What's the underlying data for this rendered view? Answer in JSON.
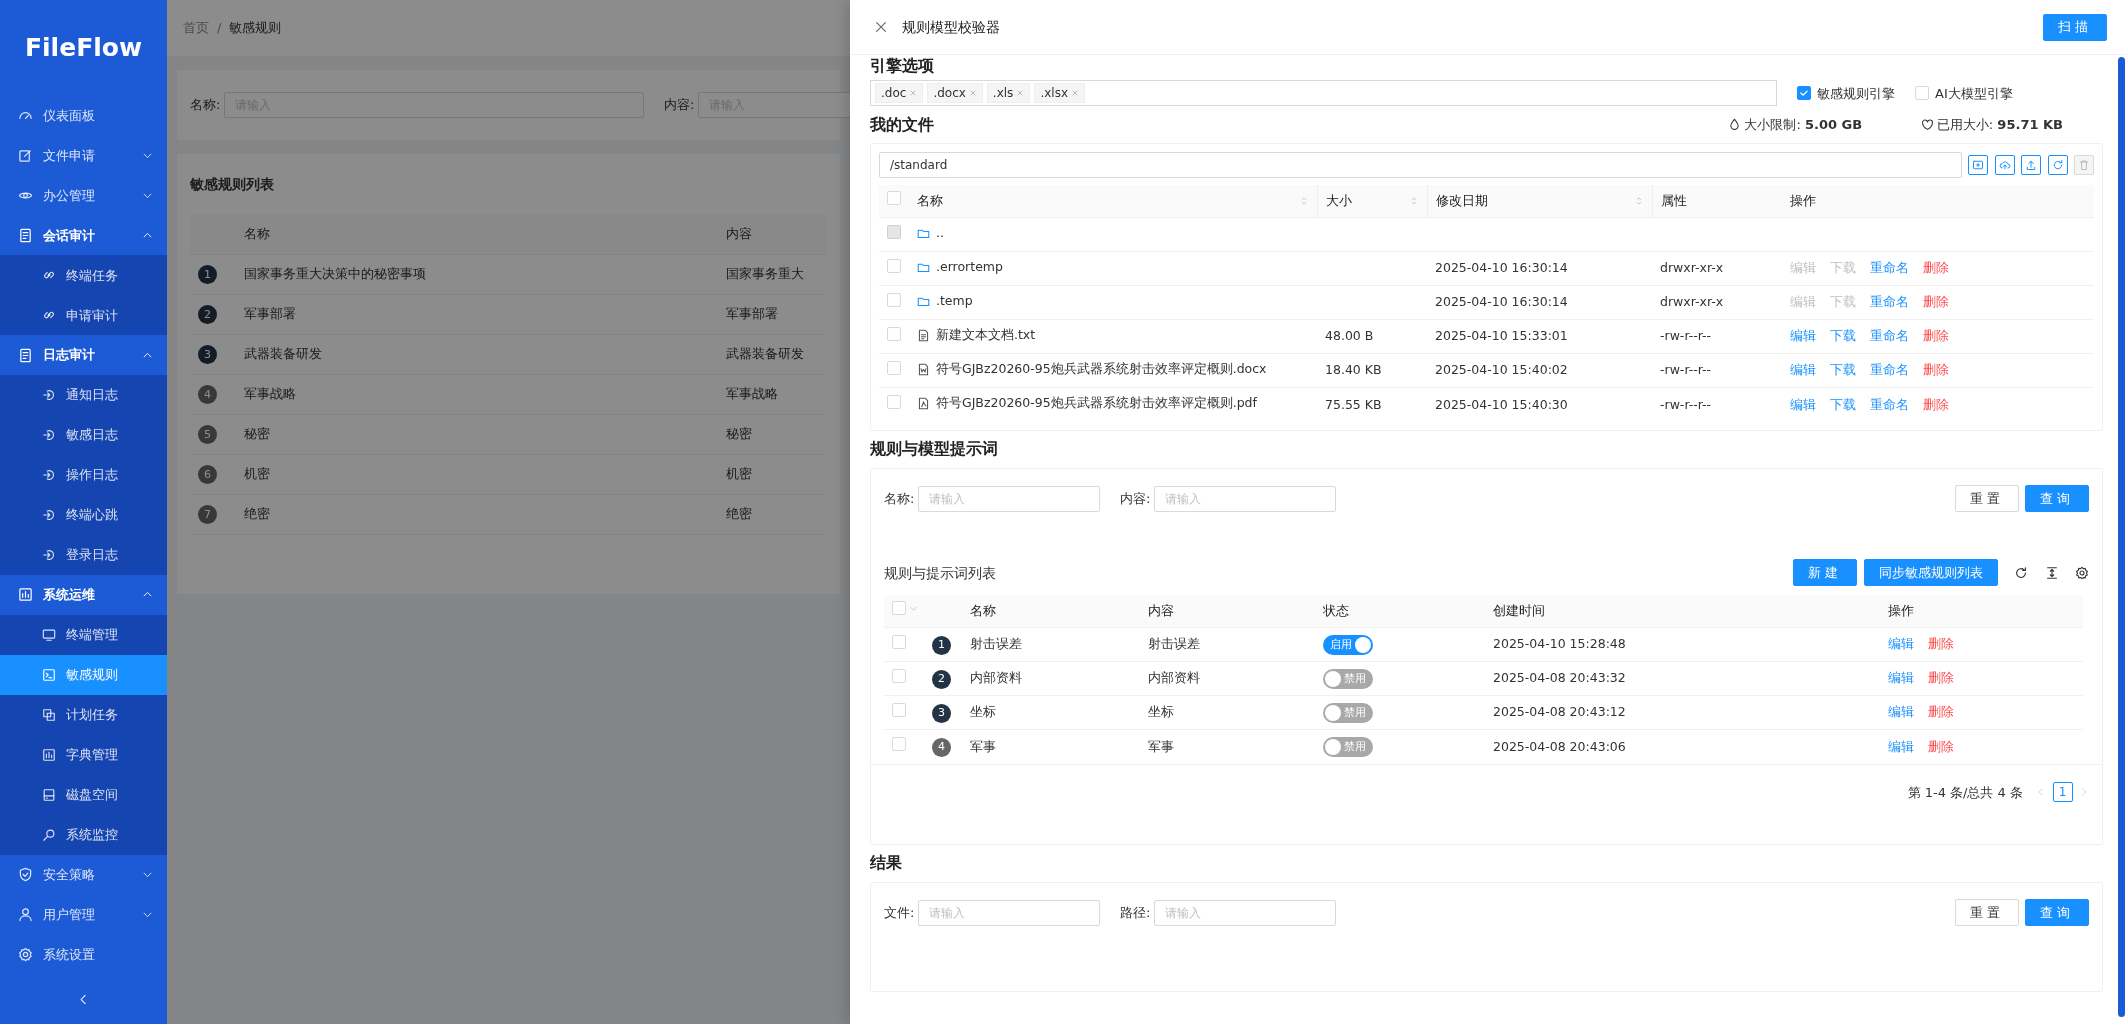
{
  "sidebar": {
    "logo": "FileFlow",
    "items": [
      {
        "label": "仪表面板",
        "selected": false
      },
      {
        "label": "文件申请",
        "selected": false,
        "expanded": false
      },
      {
        "label": "办公管理",
        "selected": false,
        "expanded": false
      },
      {
        "label": "会话审计",
        "selected": false,
        "expanded": true,
        "children": [
          {
            "label": "终端任务",
            "selected": false
          },
          {
            "label": "申请审计",
            "selected": false
          }
        ]
      },
      {
        "label": "日志审计",
        "selected": false,
        "expanded": true,
        "children": [
          {
            "label": "通知日志",
            "selected": false
          },
          {
            "label": "敏感日志",
            "selected": false
          },
          {
            "label": "操作日志",
            "selected": false
          },
          {
            "label": "终端心跳",
            "selected": false
          },
          {
            "label": "登录日志",
            "selected": false
          }
        ]
      },
      {
        "label": "系统运维",
        "selected": false,
        "expanded": true,
        "children": [
          {
            "label": "终端管理",
            "selected": false
          },
          {
            "label": "敏感规则",
            "selected": true
          },
          {
            "label": "计划任务",
            "selected": false
          },
          {
            "label": "字典管理",
            "selected": false
          },
          {
            "label": "磁盘空间",
            "selected": false
          },
          {
            "label": "系统监控",
            "selected": false
          }
        ]
      },
      {
        "label": "安全策略",
        "selected": false,
        "expanded": false
      },
      {
        "label": "用户管理",
        "selected": false,
        "expanded": false
      },
      {
        "label": "系统设置",
        "selected": false
      }
    ]
  },
  "background_page": {
    "breadcrumb": [
      "首页",
      "敏感规则"
    ],
    "breadcrumb_separator": "/",
    "filters": [
      {
        "label": "名称:",
        "placeholder": "请输入"
      },
      {
        "label": "内容:",
        "placeholder": "请输入"
      }
    ],
    "list_title": "敏感规则列表",
    "columns": [
      "名称",
      "内容"
    ],
    "rows": [
      {
        "index": "1",
        "highlight": true,
        "name": "国家事务重大决策中的秘密事项",
        "content": "国家事务重大"
      },
      {
        "index": "2",
        "highlight": true,
        "name": "军事部署",
        "content": "军事部署"
      },
      {
        "index": "3",
        "highlight": true,
        "name": "武器装备研发",
        "content": "武器装备研发"
      },
      {
        "index": "4",
        "highlight": false,
        "name": "军事战略",
        "content": "军事战略"
      },
      {
        "index": "5",
        "highlight": false,
        "name": "秘密",
        "content": "秘密"
      },
      {
        "index": "6",
        "highlight": false,
        "name": "机密",
        "content": "机密"
      },
      {
        "index": "7",
        "highlight": false,
        "name": "绝密",
        "content": "绝密"
      }
    ]
  },
  "drawer": {
    "title": "规则模型校验器",
    "scan_button": "扫描",
    "engine": {
      "heading": "引擎选项",
      "tags": [
        ".doc",
        ".docx",
        ".xls",
        ".xlsx"
      ],
      "options": [
        {
          "label": "敏感规则引擎",
          "checked": true
        },
        {
          "label": "AI大模型引擎",
          "checked": false
        }
      ]
    },
    "files": {
      "heading": "我的文件",
      "quota": [
        {
          "label": "大小限制:",
          "value": "5.00 GB"
        },
        {
          "label": "已用大小:",
          "value": "95.71 KB"
        }
      ],
      "path": "/standard",
      "select_all_checked": false,
      "toolbar": [
        {
          "disabled": false
        },
        {
          "disabled": false
        },
        {
          "disabled": false
        },
        {
          "disabled": false
        },
        {
          "disabled": true
        }
      ],
      "columns": [
        {
          "label": "名称",
          "sortable": true
        },
        {
          "label": "大小",
          "sortable": true
        },
        {
          "label": "修改日期",
          "sortable": true
        },
        {
          "label": "属性",
          "sortable": false
        },
        {
          "label": "操作",
          "sortable": false
        }
      ],
      "rows": [
        {
          "kind": "folder",
          "name": "..",
          "checked": false,
          "check_disabled": true
        },
        {
          "kind": "folder",
          "name": ".errortemp",
          "checked": false,
          "check_disabled": false,
          "modified": "2025-04-10 16:30:14",
          "mode": "drwxr-xr-x",
          "actions": [
            {
              "label": "编辑",
              "kind": "link",
              "disabled": true
            },
            {
              "label": "下载",
              "kind": "link",
              "disabled": true
            },
            {
              "label": "重命名",
              "kind": "link",
              "disabled": false
            },
            {
              "label": "删除",
              "kind": "danger",
              "disabled": false
            }
          ]
        },
        {
          "kind": "folder",
          "name": ".temp",
          "checked": false,
          "check_disabled": false,
          "modified": "2025-04-10 16:30:14",
          "mode": "drwxr-xr-x",
          "actions": [
            {
              "label": "编辑",
              "kind": "link",
              "disabled": true
            },
            {
              "label": "下载",
              "kind": "link",
              "disabled": true
            },
            {
              "label": "重命名",
              "kind": "link",
              "disabled": false
            },
            {
              "label": "删除",
              "kind": "danger",
              "disabled": false
            }
          ]
        },
        {
          "kind": "text",
          "name": "新建文本文档.txt",
          "checked": false,
          "check_disabled": false,
          "size": "48.00 B",
          "modified": "2025-04-10 15:33:01",
          "mode": "-rw-r--r--",
          "actions": [
            {
              "label": "编辑",
              "kind": "link",
              "disabled": false
            },
            {
              "label": "下载",
              "kind": "link",
              "disabled": false
            },
            {
              "label": "重命名",
              "kind": "link",
              "disabled": false
            },
            {
              "label": "删除",
              "kind": "danger",
              "disabled": false
            }
          ]
        },
        {
          "kind": "word",
          "name": "符号GJBz20260-95炮兵武器系统射击效率评定概则.docx",
          "checked": false,
          "check_disabled": false,
          "size": "18.40 KB",
          "modified": "2025-04-10 15:40:02",
          "mode": "-rw-r--r--",
          "actions": [
            {
              "label": "编辑",
              "kind": "link",
              "disabled": false
            },
            {
              "label": "下载",
              "kind": "link",
              "disabled": false
            },
            {
              "label": "重命名",
              "kind": "link",
              "disabled": false
            },
            {
              "label": "删除",
              "kind": "danger",
              "disabled": false
            }
          ]
        },
        {
          "kind": "pdf",
          "name": "符号GJBz20260-95炮兵武器系统射击效率评定概则.pdf",
          "checked": false,
          "check_disabled": false,
          "size": "75.55 KB",
          "modified": "2025-04-10 15:40:30",
          "mode": "-rw-r--r--",
          "actions": [
            {
              "label": "编辑",
              "kind": "link",
              "disabled": false
            },
            {
              "label": "下载",
              "kind": "link",
              "disabled": false
            },
            {
              "label": "重命名",
              "kind": "link",
              "disabled": false
            },
            {
              "label": "删除",
              "kind": "danger",
              "disabled": false
            }
          ]
        }
      ]
    },
    "rules": {
      "heading": "规则与模型提示词",
      "filters": [
        {
          "label": "名称:",
          "placeholder": "请输入"
        },
        {
          "label": "内容:",
          "placeholder": "请输入"
        }
      ],
      "reset_button": "重置",
      "query_button": "查询",
      "list_title": "规则与提示词列表",
      "buttons": [
        "新建",
        "同步敏感规则列表"
      ],
      "select_all_checked": false,
      "columns": [
        "名称",
        "内容",
        "状态",
        "创建时间",
        "操作"
      ],
      "rows": [
        {
          "checked": false,
          "index": "1",
          "highlight": true,
          "name": "射击误差",
          "content": "射击误差",
          "enabled": true,
          "status": "启用",
          "created": "2025-04-10 15:28:48",
          "actions": [
            {
              "label": "编辑",
              "kind": "link"
            },
            {
              "label": "删除",
              "kind": "danger"
            }
          ]
        },
        {
          "checked": false,
          "index": "2",
          "highlight": true,
          "name": "内部资料",
          "content": "内部资料",
          "enabled": false,
          "status": "禁用",
          "created": "2025-04-08 20:43:32",
          "actions": [
            {
              "label": "编辑",
              "kind": "link"
            },
            {
              "label": "删除",
              "kind": "danger"
            }
          ]
        },
        {
          "checked": false,
          "index": "3",
          "highlight": true,
          "name": "坐标",
          "content": "坐标",
          "enabled": false,
          "status": "禁用",
          "created": "2025-04-08 20:43:12",
          "actions": [
            {
              "label": "编辑",
              "kind": "link"
            },
            {
              "label": "删除",
              "kind": "danger"
            }
          ]
        },
        {
          "checked": false,
          "index": "4",
          "highlight": false,
          "name": "军事",
          "content": "军事",
          "enabled": false,
          "status": "禁用",
          "created": "2025-04-08 20:43:06",
          "actions": [
            {
              "label": "编辑",
              "kind": "link"
            },
            {
              "label": "删除",
              "kind": "danger"
            }
          ]
        }
      ],
      "pagination": {
        "summary": "第 1-4 条/总共 4 条",
        "pages": [
          {
            "label": "1",
            "selected": true
          }
        ]
      }
    },
    "result": {
      "heading": "结果",
      "filters": [
        {
          "label": "文件:",
          "placeholder": "请输入"
        },
        {
          "label": "路径:",
          "placeholder": "请输入"
        }
      ],
      "reset_button": "重置",
      "query_button": "查询"
    }
  }
}
